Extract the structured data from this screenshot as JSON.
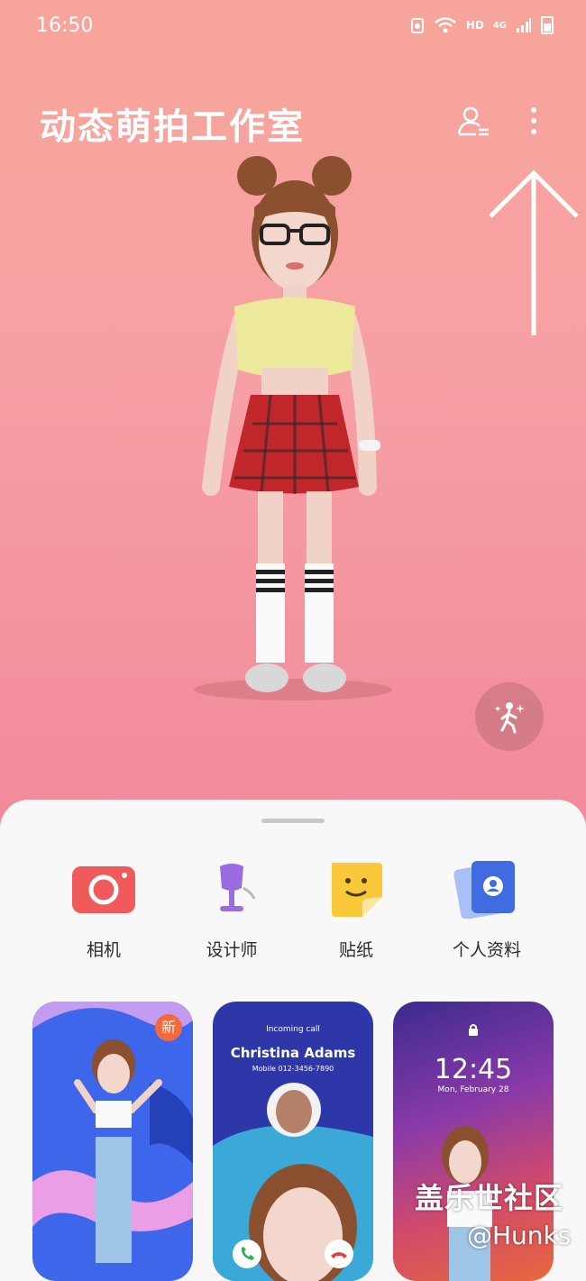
{
  "status_bar": {
    "time": "16:50",
    "hd": "HD",
    "network": "4G"
  },
  "header": {
    "title": "动态萌拍工作室",
    "profile_icon": "profile-list-icon",
    "more_icon": "more-vertical-icon"
  },
  "tools": [
    {
      "label": "相机",
      "icon": "camera-icon"
    },
    {
      "label": "设计师",
      "icon": "mannequin-icon"
    },
    {
      "label": "贴纸",
      "icon": "sticker-icon"
    },
    {
      "label": "个人资料",
      "icon": "profile-card-icon"
    }
  ],
  "cards": {
    "card1": {
      "badge": "新"
    },
    "card2": {
      "incoming": "Incoming call",
      "name": "Christina Adams",
      "mobile": "Mobile  012-3456-7890"
    },
    "card3": {
      "time": "12:45",
      "date": "Mon, February 28"
    }
  },
  "watermark": {
    "line1": "盖乐世社区",
    "line2": "@Hunks"
  },
  "colors": {
    "hero_top": "#f7a59a",
    "hero_bottom": "#f2899a",
    "camera": "#f05a5a",
    "designer": "#9b6be0",
    "sticker": "#f9c93a",
    "profile": "#3f6ce0",
    "new_badge": "#f26a3c"
  }
}
